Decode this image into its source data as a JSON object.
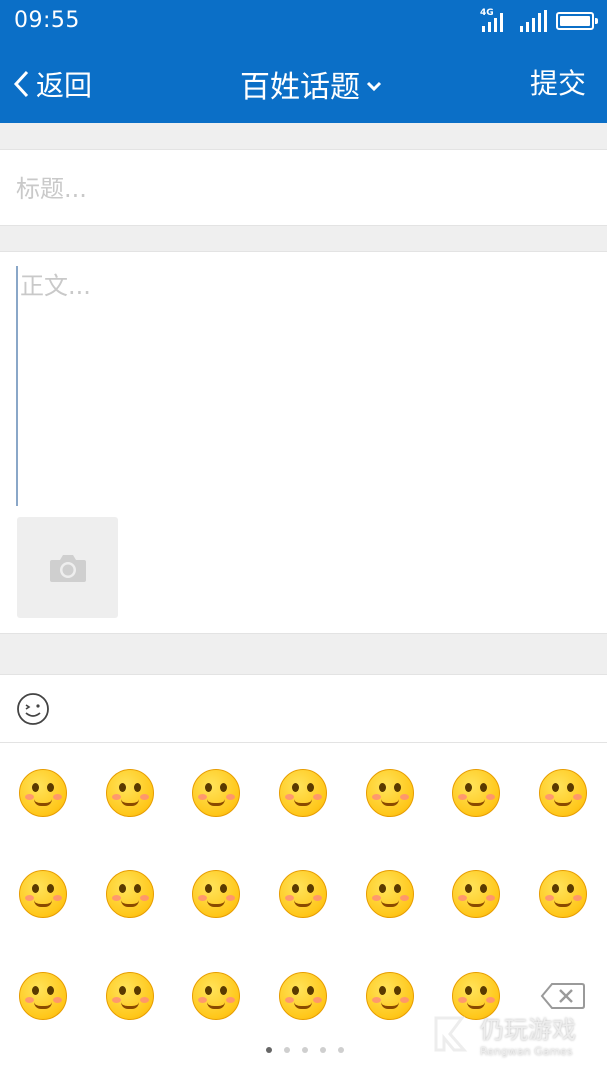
{
  "status_bar": {
    "time": "09:55",
    "network_label": "4G",
    "icons": [
      "signal-4g-icon",
      "signal-icon",
      "battery-icon"
    ]
  },
  "app_bar": {
    "back_label": "返回",
    "title": "百姓话题",
    "submit_label": "提交",
    "color": "#0b6fc7"
  },
  "form": {
    "title_placeholder": "标题...",
    "title_value": "",
    "body_placeholder": "正文...",
    "body_value": ""
  },
  "attachments": {
    "add_photo_icon": "camera-icon"
  },
  "emoji_panel": {
    "toggle_icon": "smiley-icon",
    "emojis": [
      "love-heart-emoji",
      "smirk-emoji",
      "pray-emoji",
      "wonder-emoji",
      "thinking-emoji",
      "crying-emoji",
      "wink-emoji",
      "angry-emoji",
      "mouth-sealed-emoji",
      "sick-emoji",
      "tongue-out-emoji",
      "hug-emoji",
      "shocked-sweat-emoji",
      "yawn-emoji",
      "sleepy-emoji",
      "scared-emoji",
      "toast-10t-emoji",
      "laughing-emoji",
      "blush-emoji",
      "speechless-sweat-emoji"
    ],
    "delete_icon": "backspace-icon",
    "pages": 5,
    "current_page": 1
  },
  "watermark": {
    "text_cn": "仍玩游戏",
    "text_en": "Rengwan Games"
  }
}
